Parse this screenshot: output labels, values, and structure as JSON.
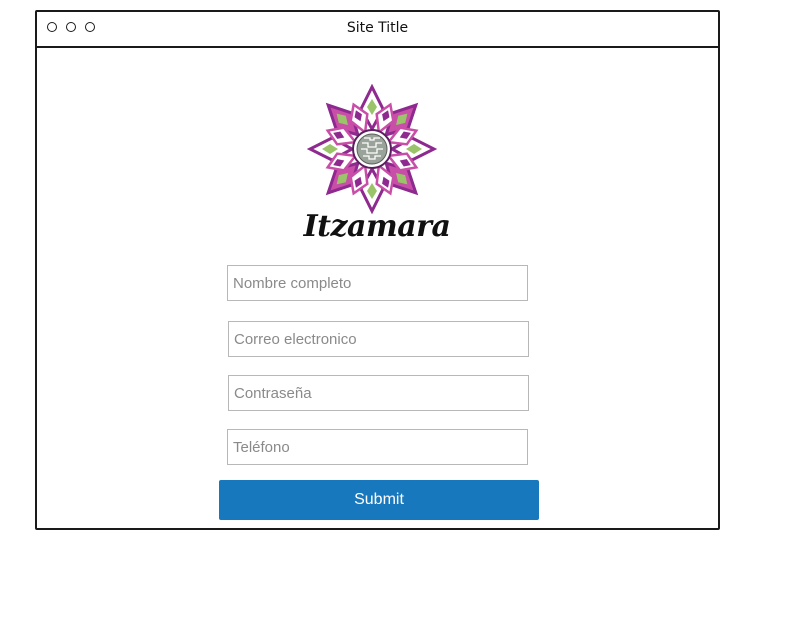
{
  "window": {
    "title": "Site Title",
    "controls": [
      "circle-icon",
      "circle-icon",
      "circle-icon"
    ]
  },
  "brand": {
    "name": "Itzamara",
    "logo_icon": "mandala-flower-logo",
    "colors": {
      "primary": "#8e2a8f",
      "secondary": "#c84ea8",
      "accent": "#9bc46a"
    }
  },
  "form": {
    "fields": [
      {
        "placeholder": "Nombre completo",
        "value": ""
      },
      {
        "placeholder": "Correo electronico",
        "value": ""
      },
      {
        "placeholder": "Contraseña",
        "value": ""
      },
      {
        "placeholder": "Teléfono",
        "value": ""
      }
    ],
    "submit_label": "Submit",
    "submit_color": "#1878bd"
  }
}
